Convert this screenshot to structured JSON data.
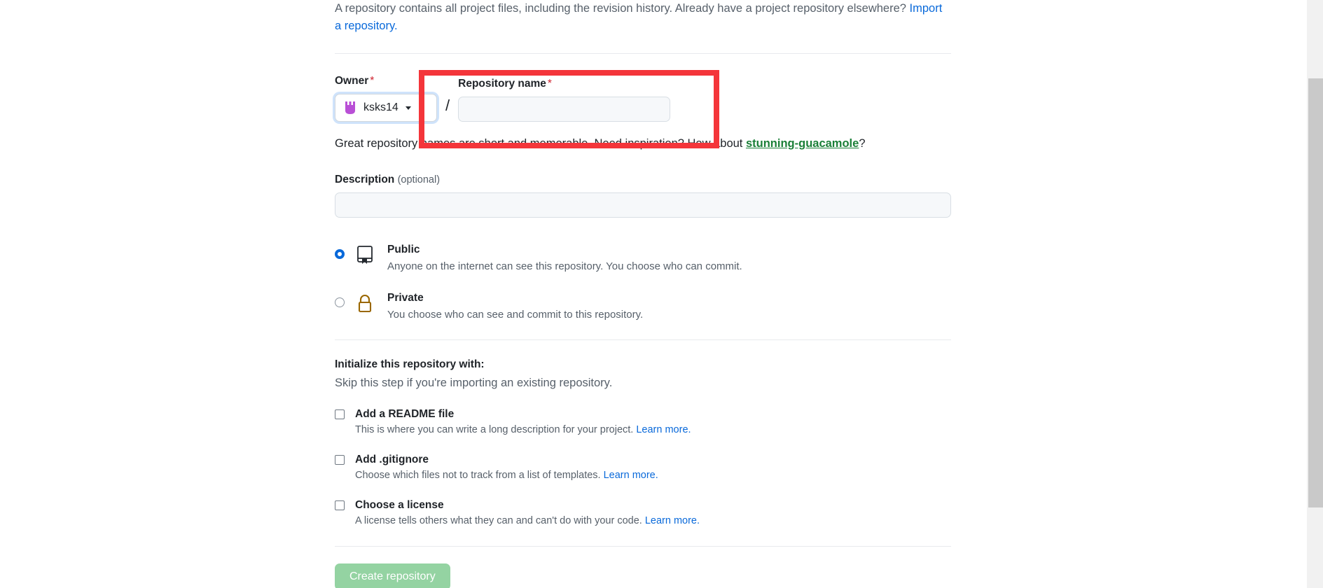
{
  "intro": {
    "text": "A repository contains all project files, including the revision history. Already have a project repository elsewhere?",
    "import_link": "Import a repository."
  },
  "owner": {
    "label": "Owner",
    "required_mark": "*",
    "name": "ksks14",
    "avatar_icon": "user-avatar-identicon",
    "caret_icon": "chevron-down-icon"
  },
  "separator": "/",
  "repository_name": {
    "label": "Repository name",
    "required_mark": "*",
    "value": "",
    "placeholder": ""
  },
  "hint": {
    "before": "Great repository names are short and memorable. Need inspiration? How about ",
    "suggestion": "stunning-guacamole",
    "after": "?"
  },
  "description": {
    "label": "Description",
    "optional": "(optional)",
    "value": "",
    "placeholder": ""
  },
  "visibility": [
    {
      "id": "public",
      "title": "Public",
      "desc": "Anyone on the internet can see this repository. You choose who can commit.",
      "selected": true,
      "icon": "repo-book-icon"
    },
    {
      "id": "private",
      "title": "Private",
      "desc": "You choose who can see and commit to this repository.",
      "selected": false,
      "icon": "lock-icon"
    }
  ],
  "initialize": {
    "title": "Initialize this repository with:",
    "subtitle": "Skip this step if you're importing an existing repository.",
    "options": [
      {
        "id": "readme",
        "label": "Add a README file",
        "desc": "This is where you can write a long description for your project. ",
        "link": "Learn more.",
        "checked": false
      },
      {
        "id": "gitignore",
        "label": "Add .gitignore",
        "desc": "Choose which files not to track from a list of templates. ",
        "link": "Learn more.",
        "checked": false
      },
      {
        "id": "license",
        "label": "Choose a license",
        "desc": "A license tells others what they can and can't do with your code. ",
        "link": "Learn more.",
        "checked": false
      }
    ]
  },
  "submit": {
    "label": "Create repository",
    "enabled": false
  },
  "annotation": {
    "color": "#f4353a",
    "target": "repository-name-field"
  },
  "colors": {
    "link": "#0969da",
    "required": "#cf222e",
    "suggestion": "#1a7f37",
    "submit_bg": "#94d3a2",
    "lock": "#9a6700"
  }
}
